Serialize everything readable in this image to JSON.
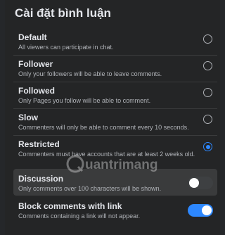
{
  "title": "Cài đặt bình luận",
  "options": [
    {
      "label": "Default",
      "description": "All viewers can participate in chat.",
      "selected": false
    },
    {
      "label": "Follower",
      "description": "Only your followers will be able to leave comments.",
      "selected": false
    },
    {
      "label": "Followed",
      "description": "Only Pages you follow will be able to comment.",
      "selected": false
    },
    {
      "label": "Slow",
      "description": "Commenters will only be able to comment every 10 seconds.",
      "selected": false
    },
    {
      "label": "Restricted",
      "description": "Commenters must have accounts that are at least 2 weeks old.",
      "selected": true
    }
  ],
  "toggles": [
    {
      "label": "Discussion",
      "description": "Only comments over 100 characters will be shown.",
      "on": false
    },
    {
      "label": "Block comments with link",
      "description": "Comments containing a link will not appear.",
      "on": true
    }
  ],
  "colors": {
    "accent": "#2d88ff",
    "background": "#242526"
  },
  "watermark": "Quantrimang"
}
